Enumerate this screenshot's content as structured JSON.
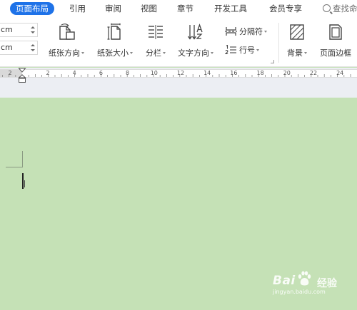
{
  "tabs": [
    {
      "label": "页面布局",
      "active": true
    },
    {
      "label": "引用",
      "active": false
    },
    {
      "label": "审阅",
      "active": false
    },
    {
      "label": "视图",
      "active": false
    },
    {
      "label": "章节",
      "active": false
    },
    {
      "label": "开发工具",
      "active": false
    },
    {
      "label": "会员专享",
      "active": false
    }
  ],
  "search": {
    "label": "查找命",
    "icon": "search-icon"
  },
  "margins": {
    "top_value": "cm",
    "bottom_value": "cm"
  },
  "ribbon": {
    "orientation": {
      "label": "纸张方向",
      "icon": "page-orientation-icon"
    },
    "size": {
      "label": "纸张大小",
      "icon": "page-size-icon"
    },
    "columns": {
      "label": "分栏",
      "icon": "columns-icon"
    },
    "text_direction": {
      "label": "文字方向",
      "icon": "text-direction-icon"
    },
    "breaks": {
      "label": "分隔符",
      "icon": "breaks-icon"
    },
    "line_numbers": {
      "label": "行号",
      "icon": "line-numbers-icon"
    },
    "background": {
      "label": "背景",
      "icon": "background-icon"
    },
    "page_border": {
      "label": "页面边框",
      "icon": "page-border-icon"
    }
  },
  "ruler": {
    "labels": [
      "2",
      "2",
      "4",
      "6",
      "8",
      "10",
      "12",
      "14",
      "16",
      "18",
      "20",
      "22",
      "24"
    ]
  },
  "watermark": {
    "brand": "Bai",
    "brand_suffix": "经验",
    "url": "jingyan.baidu.com"
  },
  "colors": {
    "accent": "#1e72e8",
    "document_bg": "#c5e1b6"
  }
}
